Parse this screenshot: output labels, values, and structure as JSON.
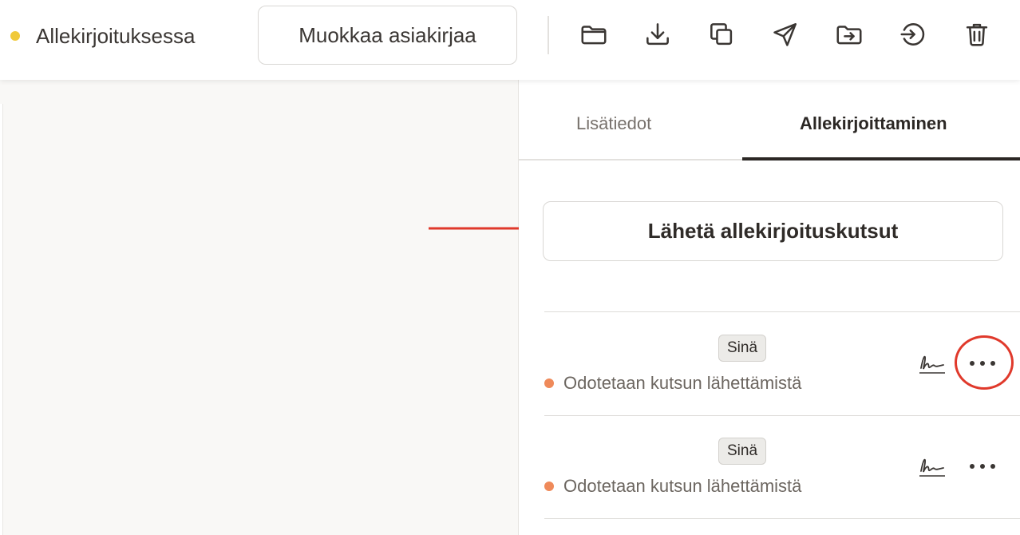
{
  "topbar": {
    "status_label": "Allekirjoituksessa",
    "status_color": "#f0c93a",
    "edit_button_label": "Muokkaa asiakirjaa",
    "tools": [
      "folder-icon",
      "download-icon",
      "copy-icon",
      "send-icon",
      "move-to-folder-icon",
      "sign-in-icon",
      "trash-icon"
    ]
  },
  "panel": {
    "tabs": [
      {
        "label": "Lisätiedot",
        "active": false
      },
      {
        "label": "Allekirjoittaminen",
        "active": true
      }
    ],
    "send_button_label": "Lähetä allekirjoituskutsut",
    "signers": [
      {
        "badge": "Sinä",
        "status": "Odotetaan kutsun lähettämistä",
        "status_color": "#ef8a5a",
        "highlighted": true
      },
      {
        "badge": "Sinä",
        "status": "Odotetaan kutsun lähettämistä",
        "status_color": "#ef8a5a",
        "highlighted": false
      }
    ]
  },
  "annotation": {
    "color": "#e0392b"
  }
}
